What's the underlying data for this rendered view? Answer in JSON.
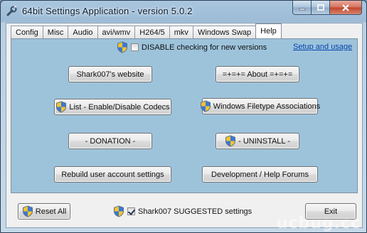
{
  "window": {
    "title": "64bit Settings Application - version 5.0.2"
  },
  "tabs": [
    {
      "label": "Config"
    },
    {
      "label": "Misc"
    },
    {
      "label": "Audio"
    },
    {
      "label": "avi/wmv"
    },
    {
      "label": "H264/5"
    },
    {
      "label": "mkv"
    },
    {
      "label": "Windows Swap"
    },
    {
      "label": "Help",
      "active": true
    }
  ],
  "help": {
    "disable_check_label": "DISABLE checking for new versions",
    "disable_check_checked": false,
    "setup_link": "Setup and usage",
    "buttons": {
      "website": "Shark007's website",
      "about": "=+=+= About =+=+=",
      "codecs": "List - Enable/Disable Codecs",
      "filetype": "Windows Filetype Associations",
      "donation": "- DONATION -",
      "uninstall": "- UNINSTALL -",
      "rebuild": "Rebuild user account settings",
      "forums": "Development / Help Forums"
    }
  },
  "footer": {
    "reset_label": "Reset All",
    "suggested_label": "Shark007 SUGGESTED settings",
    "suggested_checked": true,
    "exit_label": "Exit"
  },
  "watermark": "ucbug.cc",
  "colors": {
    "panel": "#9dc3db",
    "titlebar": "#9dbbd5",
    "link": "#0645ad"
  },
  "icons": {
    "app": "wrench-icon",
    "uac": "uac-shield-icon"
  }
}
